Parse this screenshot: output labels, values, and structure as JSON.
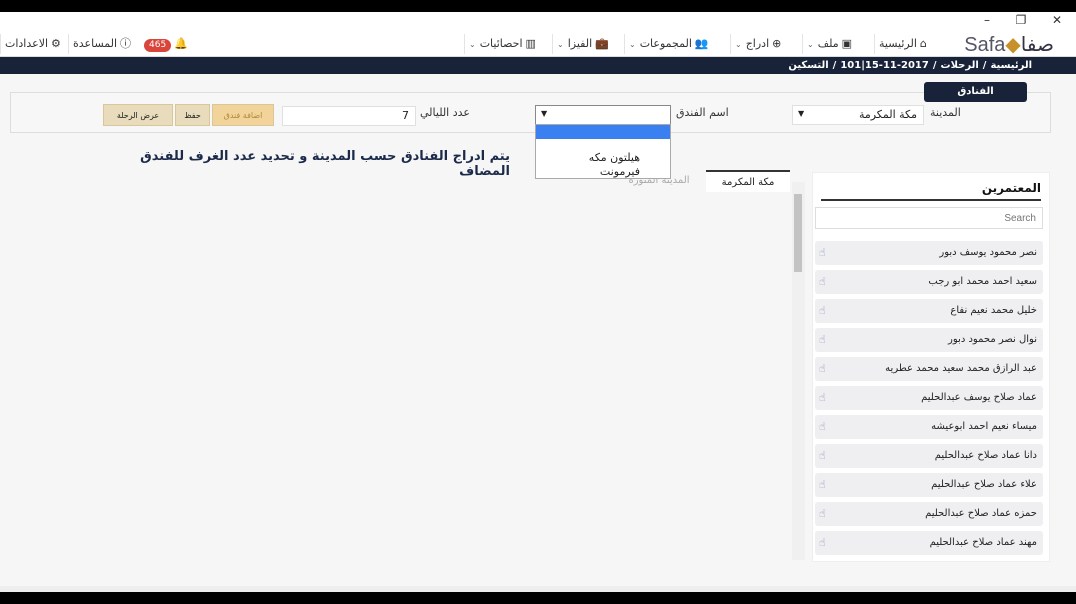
{
  "window": {
    "minimize": "–",
    "restore": "❐",
    "close": "✕"
  },
  "toolbar": {
    "logo_ar": "صفا",
    "logo_en": "Safa",
    "home": "الرئيسية",
    "file": "ملف",
    "insert": "ادراج",
    "groups": "المجموعات",
    "visa": "الفيزا",
    "stats": "احصائيات",
    "notifications_count": "465",
    "help": "المساعدة",
    "settings": "الاعدادات"
  },
  "breadcrumb": [
    "الرئيسية",
    "الرحلات",
    "2017-11-15|101",
    "التسكين"
  ],
  "hotels_panel": {
    "tab_label": "الفنادق",
    "city_label": "المدينة",
    "city_value": "مكة المكرمة",
    "hotel_label": "اسم الفندق",
    "hotel_value": "",
    "hotel_options": [
      "",
      "هيلتون مكه",
      "فيرمونت"
    ],
    "nights_label": "عدد الليالي",
    "nights_value": "7",
    "add_hotel": "اضافة فندق",
    "save": "حفظ",
    "view_trip": "عرض الرحلة"
  },
  "heading": "يتم ادراج الفنادق حسب المدينة و تحديد عدد الغرف للفندق المضاف",
  "city_tabs": [
    {
      "label": "مكة المكرمة",
      "active": true
    },
    {
      "label": "المدينة المنورة",
      "active": false
    }
  ],
  "pilgrims": {
    "title": "المعتمرين",
    "search_placeholder": "Search",
    "items": [
      "نصر محمود يوسف دبور",
      "سعيد احمد محمد ابو رجب",
      "خليل محمد نعيم نفاع",
      "نوال نصر محمود دبور",
      "عبد الرازق محمد سعيد محمد عطريه",
      "عماد صلاح يوسف عبدالحليم",
      "ميساء نعيم احمد ابوعيشه",
      "دانا عماد صلاح عبدالحليم",
      "علاء عماد صلاح عبدالحليم",
      "حمزه عماد صلاح عبدالحليم",
      "مهند عماد صلاح عبدالحليم"
    ]
  },
  "colors": {
    "navy": "#18233a",
    "badge": "#d9453b",
    "button_gold": "#f2d49a",
    "highlight": "#3a80f0"
  }
}
